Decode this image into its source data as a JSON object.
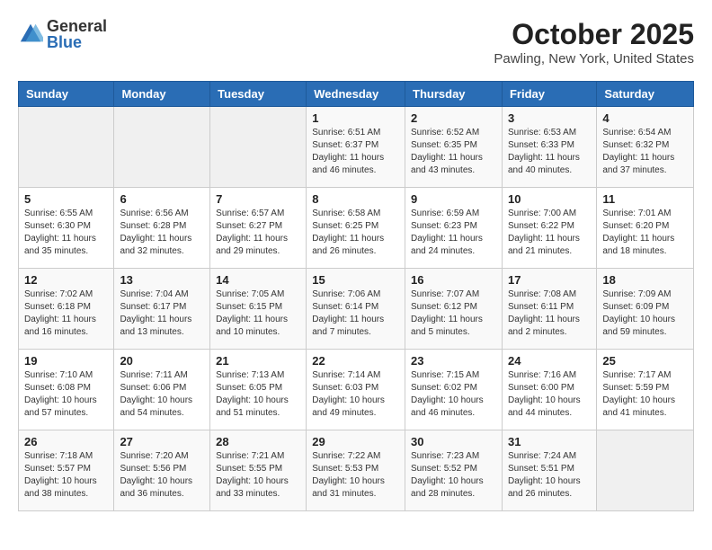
{
  "logo": {
    "general": "General",
    "blue": "Blue"
  },
  "title": "October 2025",
  "location": "Pawling, New York, United States",
  "weekdays": [
    "Sunday",
    "Monday",
    "Tuesday",
    "Wednesday",
    "Thursday",
    "Friday",
    "Saturday"
  ],
  "weeks": [
    [
      {
        "day": "",
        "info": ""
      },
      {
        "day": "",
        "info": ""
      },
      {
        "day": "",
        "info": ""
      },
      {
        "day": "1",
        "info": "Sunrise: 6:51 AM\nSunset: 6:37 PM\nDaylight: 11 hours and 46 minutes."
      },
      {
        "day": "2",
        "info": "Sunrise: 6:52 AM\nSunset: 6:35 PM\nDaylight: 11 hours and 43 minutes."
      },
      {
        "day": "3",
        "info": "Sunrise: 6:53 AM\nSunset: 6:33 PM\nDaylight: 11 hours and 40 minutes."
      },
      {
        "day": "4",
        "info": "Sunrise: 6:54 AM\nSunset: 6:32 PM\nDaylight: 11 hours and 37 minutes."
      }
    ],
    [
      {
        "day": "5",
        "info": "Sunrise: 6:55 AM\nSunset: 6:30 PM\nDaylight: 11 hours and 35 minutes."
      },
      {
        "day": "6",
        "info": "Sunrise: 6:56 AM\nSunset: 6:28 PM\nDaylight: 11 hours and 32 minutes."
      },
      {
        "day": "7",
        "info": "Sunrise: 6:57 AM\nSunset: 6:27 PM\nDaylight: 11 hours and 29 minutes."
      },
      {
        "day": "8",
        "info": "Sunrise: 6:58 AM\nSunset: 6:25 PM\nDaylight: 11 hours and 26 minutes."
      },
      {
        "day": "9",
        "info": "Sunrise: 6:59 AM\nSunset: 6:23 PM\nDaylight: 11 hours and 24 minutes."
      },
      {
        "day": "10",
        "info": "Sunrise: 7:00 AM\nSunset: 6:22 PM\nDaylight: 11 hours and 21 minutes."
      },
      {
        "day": "11",
        "info": "Sunrise: 7:01 AM\nSunset: 6:20 PM\nDaylight: 11 hours and 18 minutes."
      }
    ],
    [
      {
        "day": "12",
        "info": "Sunrise: 7:02 AM\nSunset: 6:18 PM\nDaylight: 11 hours and 16 minutes."
      },
      {
        "day": "13",
        "info": "Sunrise: 7:04 AM\nSunset: 6:17 PM\nDaylight: 11 hours and 13 minutes."
      },
      {
        "day": "14",
        "info": "Sunrise: 7:05 AM\nSunset: 6:15 PM\nDaylight: 11 hours and 10 minutes."
      },
      {
        "day": "15",
        "info": "Sunrise: 7:06 AM\nSunset: 6:14 PM\nDaylight: 11 hours and 7 minutes."
      },
      {
        "day": "16",
        "info": "Sunrise: 7:07 AM\nSunset: 6:12 PM\nDaylight: 11 hours and 5 minutes."
      },
      {
        "day": "17",
        "info": "Sunrise: 7:08 AM\nSunset: 6:11 PM\nDaylight: 11 hours and 2 minutes."
      },
      {
        "day": "18",
        "info": "Sunrise: 7:09 AM\nSunset: 6:09 PM\nDaylight: 10 hours and 59 minutes."
      }
    ],
    [
      {
        "day": "19",
        "info": "Sunrise: 7:10 AM\nSunset: 6:08 PM\nDaylight: 10 hours and 57 minutes."
      },
      {
        "day": "20",
        "info": "Sunrise: 7:11 AM\nSunset: 6:06 PM\nDaylight: 10 hours and 54 minutes."
      },
      {
        "day": "21",
        "info": "Sunrise: 7:13 AM\nSunset: 6:05 PM\nDaylight: 10 hours and 51 minutes."
      },
      {
        "day": "22",
        "info": "Sunrise: 7:14 AM\nSunset: 6:03 PM\nDaylight: 10 hours and 49 minutes."
      },
      {
        "day": "23",
        "info": "Sunrise: 7:15 AM\nSunset: 6:02 PM\nDaylight: 10 hours and 46 minutes."
      },
      {
        "day": "24",
        "info": "Sunrise: 7:16 AM\nSunset: 6:00 PM\nDaylight: 10 hours and 44 minutes."
      },
      {
        "day": "25",
        "info": "Sunrise: 7:17 AM\nSunset: 5:59 PM\nDaylight: 10 hours and 41 minutes."
      }
    ],
    [
      {
        "day": "26",
        "info": "Sunrise: 7:18 AM\nSunset: 5:57 PM\nDaylight: 10 hours and 38 minutes."
      },
      {
        "day": "27",
        "info": "Sunrise: 7:20 AM\nSunset: 5:56 PM\nDaylight: 10 hours and 36 minutes."
      },
      {
        "day": "28",
        "info": "Sunrise: 7:21 AM\nSunset: 5:55 PM\nDaylight: 10 hours and 33 minutes."
      },
      {
        "day": "29",
        "info": "Sunrise: 7:22 AM\nSunset: 5:53 PM\nDaylight: 10 hours and 31 minutes."
      },
      {
        "day": "30",
        "info": "Sunrise: 7:23 AM\nSunset: 5:52 PM\nDaylight: 10 hours and 28 minutes."
      },
      {
        "day": "31",
        "info": "Sunrise: 7:24 AM\nSunset: 5:51 PM\nDaylight: 10 hours and 26 minutes."
      },
      {
        "day": "",
        "info": ""
      }
    ]
  ]
}
